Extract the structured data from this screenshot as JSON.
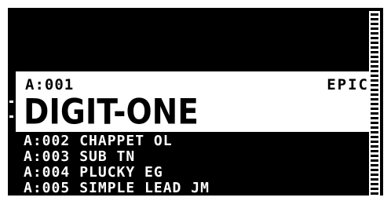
{
  "selected": {
    "code": "A:001",
    "category": "EPIC",
    "name": "DIGIT-ONE"
  },
  "list": [
    {
      "code": "A:002",
      "name": "CHAPPET OL"
    },
    {
      "code": "A:003",
      "name": "SUB TN"
    },
    {
      "code": "A:004",
      "name": "PLUCKY EG"
    },
    {
      "code": "A:005",
      "name": "SIMPLE LEAD JM"
    }
  ],
  "colors": {
    "screen": "#000000",
    "highlight": "#ffffff"
  }
}
